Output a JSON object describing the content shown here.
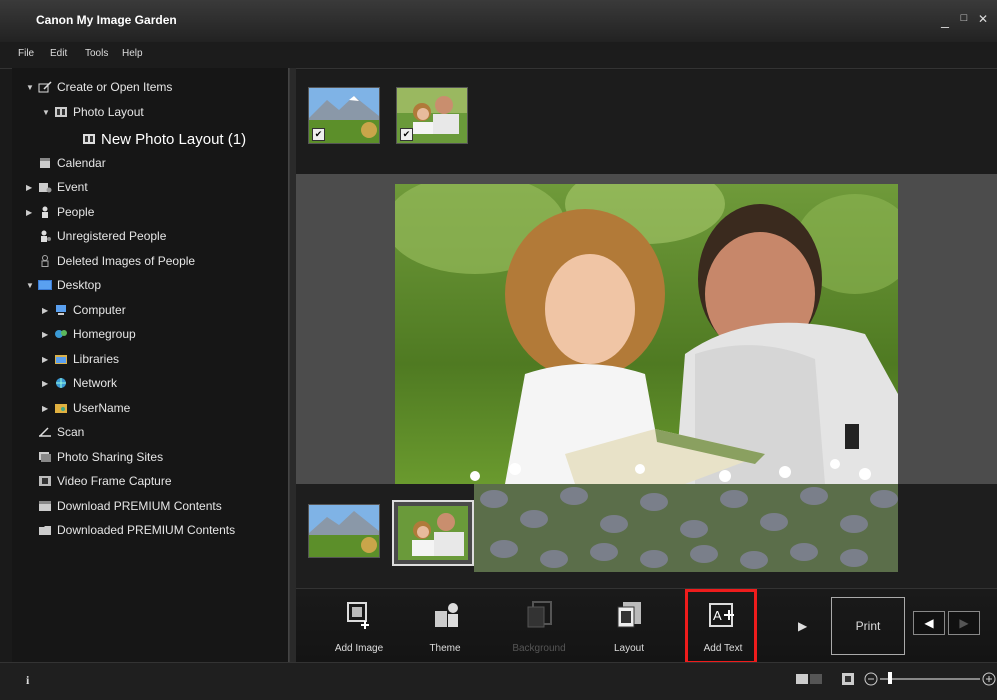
{
  "window": {
    "title": "Canon My Image Garden",
    "minimize": "_",
    "maximize": "□",
    "close": "✕"
  },
  "menu": [
    "File",
    "Edit",
    "Tools",
    "Help"
  ],
  "sidebar": {
    "items": [
      {
        "label": "Create or Open Items",
        "arrow": "▼",
        "icon": "create-items-icon"
      },
      {
        "label": "Photo Layout",
        "arrow": "▼",
        "icon": "photo-layout-icon"
      },
      {
        "label": "New Photo Layout (1)",
        "arrow": "",
        "icon": "layout-item-icon",
        "selected": true
      },
      {
        "label": "Calendar",
        "arrow": "",
        "icon": "calendar-icon"
      },
      {
        "label": "Event",
        "arrow": "▶",
        "icon": "event-icon"
      },
      {
        "label": "People",
        "arrow": "▶",
        "icon": "people-icon"
      },
      {
        "label": "Unregistered People",
        "arrow": "",
        "icon": "unregistered-people-icon"
      },
      {
        "label": "Deleted Images of People",
        "arrow": "",
        "icon": "deleted-people-icon"
      },
      {
        "label": "Desktop",
        "arrow": "▼",
        "icon": "desktop-icon"
      },
      {
        "label": "Computer",
        "arrow": "▶",
        "icon": "computer-icon"
      },
      {
        "label": "Homegroup",
        "arrow": "▶",
        "icon": "homegroup-icon"
      },
      {
        "label": "Libraries",
        "arrow": "▶",
        "icon": "libraries-icon"
      },
      {
        "label": "Network",
        "arrow": "▶",
        "icon": "network-icon"
      },
      {
        "label": "UserName",
        "arrow": "▶",
        "icon": "user-folder-icon"
      },
      {
        "label": "Scan",
        "arrow": "",
        "icon": "scan-icon"
      },
      {
        "label": "Photo Sharing Sites",
        "arrow": "",
        "icon": "photo-sharing-icon"
      },
      {
        "label": "Video Frame Capture",
        "arrow": "",
        "icon": "video-frame-icon"
      },
      {
        "label": "Download PREMIUM Contents",
        "arrow": "",
        "icon": "download-premium-icon"
      },
      {
        "label": "Downloaded PREMIUM Contents",
        "arrow": "",
        "icon": "downloaded-premium-icon"
      }
    ]
  },
  "toolbar": {
    "add_image": "Add Image",
    "theme": "Theme",
    "background": "Background",
    "layout": "Layout",
    "add_text": "Add Text",
    "expand": "▶",
    "print": "Print",
    "prev": "◀",
    "next": "▶"
  },
  "status": {
    "info": "i"
  },
  "colors": {
    "highlight": "#ee1c1c",
    "accent": "#3a7bd5"
  }
}
